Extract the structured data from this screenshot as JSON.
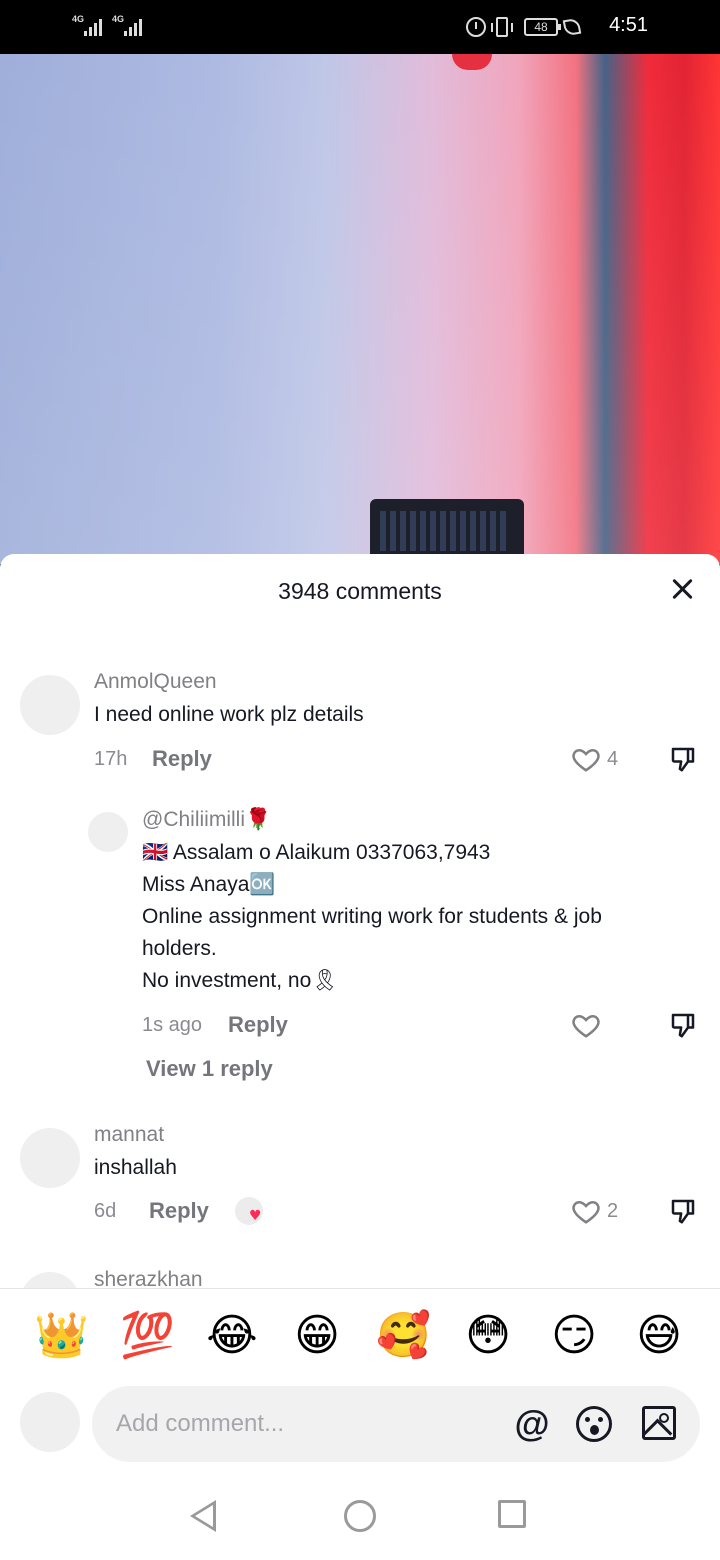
{
  "status_bar": {
    "signal_1": "4G",
    "signal_2": "4G",
    "battery": "48",
    "time": "4:51"
  },
  "comments_panel": {
    "title": "3948 comments",
    "comments": [
      {
        "username": "AnmolQueen",
        "text": "I need online work plz details",
        "time": "17h",
        "reply_label": "Reply",
        "likes": "4"
      },
      {
        "username": "@Chiliimilli🌹",
        "lines": [
          "🇬🇧 Assalam o Alaikum 0337063,7943",
          "Miss Anaya🆗",
          "Online assignment writing work for students & job",
          "holders.",
          "No investment, no🎗"
        ],
        "time": "1s ago",
        "reply_label": "Reply",
        "view_replies": "View 1 reply"
      },
      {
        "username": "mannat",
        "text": "inshallah",
        "time": "6d",
        "reply_label": "Reply",
        "likes": "2"
      },
      {
        "username": "sherazkhan"
      }
    ]
  },
  "emoji_bar": [
    "👑",
    "💯",
    "😂",
    "😁",
    "🥰",
    "😳",
    "😏",
    "😅"
  ],
  "comment_input": {
    "placeholder": "Add comment...",
    "mention_symbol": "@"
  }
}
